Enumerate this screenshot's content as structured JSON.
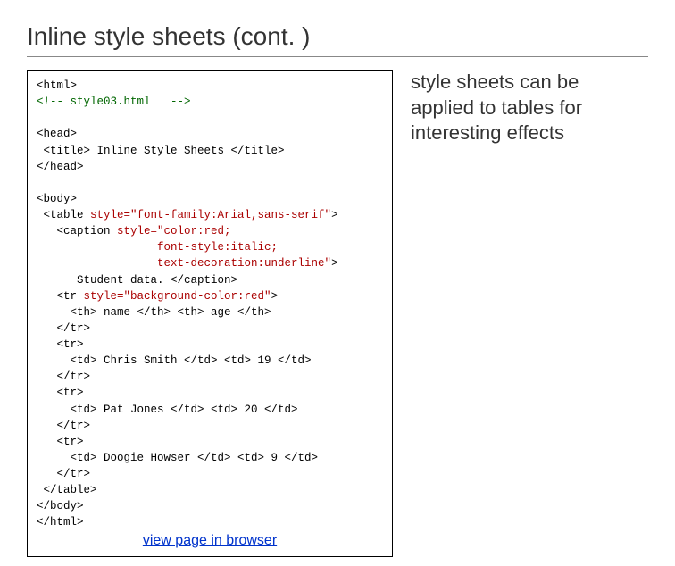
{
  "title": "Inline style sheets (cont. )",
  "description": "style sheets can be applied to tables for interesting effects",
  "link_label": "view page in browser",
  "code": {
    "l1": "<html>",
    "l2": "<!-- style03.html   -->",
    "l3": "",
    "l4": "<head>",
    "l5": " <title> Inline Style Sheets </title>",
    "l6": "</head>",
    "l7": "",
    "l8": "<body>",
    "l9a": " <table ",
    "l9b": "style=\"font-family:Arial,sans-serif\"",
    "l9c": ">",
    "l10a": "   <caption ",
    "l10b": "style=\"color:red;",
    "l11": "                  font-style:italic;",
    "l12a": "                  text-decoration:underline\"",
    "l12b": ">",
    "l13": "      Student data. </caption>",
    "l14a": "   <tr ",
    "l14b": "style=\"background-color:red\"",
    "l14c": ">",
    "l15": "     <th> name </th> <th> age </th>",
    "l16": "   </tr>",
    "l17": "   <tr>",
    "l18": "     <td> Chris Smith </td> <td> 19 </td>",
    "l19": "   </tr>",
    "l20": "   <tr>",
    "l21": "     <td> Pat Jones </td> <td> 20 </td>",
    "l22": "   </tr>",
    "l23": "   <tr>",
    "l24": "     <td> Doogie Howser </td> <td> 9 </td>",
    "l25": "   </tr>",
    "l26": " </table>",
    "l27": "</body>",
    "l28": "</html>"
  }
}
